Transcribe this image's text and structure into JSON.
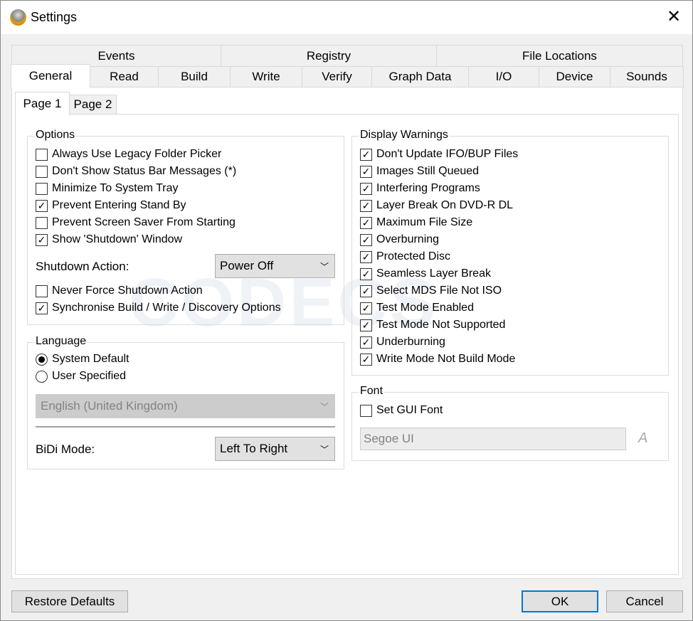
{
  "window": {
    "title": "Settings",
    "close_icon": "close-icon"
  },
  "tabs_top": [
    "Events",
    "Registry",
    "File Locations"
  ],
  "tabs_main": [
    "General",
    "Read",
    "Build",
    "Write",
    "Verify",
    "Graph Data",
    "I/O",
    "Device",
    "Sounds"
  ],
  "subtabs": [
    "Page 1",
    "Page 2"
  ],
  "options": {
    "title": "Options",
    "items": [
      {
        "label": "Always Use Legacy Folder Picker",
        "checked": false
      },
      {
        "label": "Don't Show Status Bar Messages (*)",
        "checked": false
      },
      {
        "label": "Minimize To System Tray",
        "checked": false
      },
      {
        "label": "Prevent Entering Stand By",
        "checked": true
      },
      {
        "label": "Prevent Screen Saver From Starting",
        "checked": false
      },
      {
        "label": "Show 'Shutdown' Window",
        "checked": true
      }
    ],
    "shutdown_label": "Shutdown Action:",
    "shutdown_value": "Power Off",
    "items2": [
      {
        "label": "Never Force Shutdown Action",
        "checked": false
      },
      {
        "label": "Synchronise Build / Write / Discovery Options",
        "checked": true
      }
    ]
  },
  "language": {
    "title": "Language",
    "radios": [
      {
        "label": "System Default",
        "selected": true
      },
      {
        "label": "User Specified",
        "selected": false
      }
    ],
    "language_value": "English (United Kingdom)",
    "bidi_label": "BiDi Mode:",
    "bidi_value": "Left To Right"
  },
  "warnings": {
    "title": "Display Warnings",
    "items": [
      "Don't Update IFO/BUP Files",
      "Images Still Queued",
      "Interfering Programs",
      "Layer Break On DVD-R DL",
      "Maximum File Size",
      "Overburning",
      "Protected Disc",
      "Seamless Layer Break",
      "Select MDS File Not ISO",
      "Test Mode Enabled",
      "Test Mode Not Supported",
      "Underburning",
      "Write Mode Not Build Mode"
    ]
  },
  "font": {
    "title": "Font",
    "set_label": "Set GUI Font",
    "checked": false,
    "value": "Segoe UI"
  },
  "buttons": {
    "restore": "Restore Defaults",
    "ok": "OK",
    "cancel": "Cancel"
  }
}
